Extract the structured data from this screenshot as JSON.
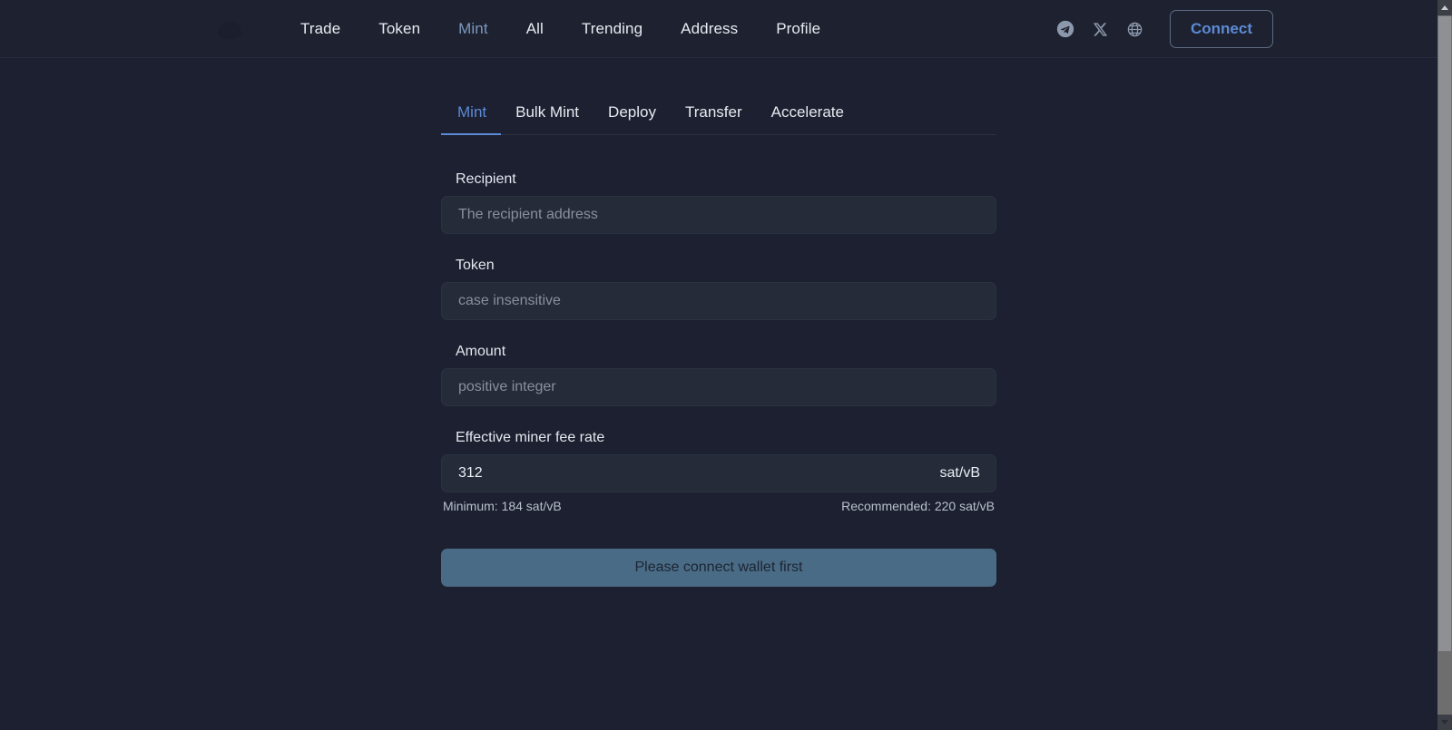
{
  "header": {
    "logo_alt": "site-logo",
    "nav": [
      {
        "label": "Trade",
        "active": false
      },
      {
        "label": "Token",
        "active": false
      },
      {
        "label": "Mint",
        "active": true
      },
      {
        "label": "All",
        "active": false
      },
      {
        "label": "Trending",
        "active": false
      },
      {
        "label": "Address",
        "active": false
      },
      {
        "label": "Profile",
        "active": false
      }
    ],
    "social": [
      {
        "name": "telegram-icon"
      },
      {
        "name": "x-twitter-icon"
      },
      {
        "name": "globe-icon"
      }
    ],
    "connect_label": "Connect"
  },
  "tabs": [
    {
      "label": "Mint",
      "active": true
    },
    {
      "label": "Bulk Mint",
      "active": false
    },
    {
      "label": "Deploy",
      "active": false
    },
    {
      "label": "Transfer",
      "active": false
    },
    {
      "label": "Accelerate",
      "active": false
    }
  ],
  "form": {
    "recipient": {
      "label": "Recipient",
      "placeholder": "The recipient address",
      "value": ""
    },
    "token": {
      "label": "Token",
      "placeholder": "case insensitive",
      "value": ""
    },
    "amount": {
      "label": "Amount",
      "placeholder": "positive integer",
      "value": ""
    },
    "fee_rate": {
      "label": "Effective miner fee rate",
      "value": "312",
      "unit": "sat/vB",
      "minimum_hint": "Minimum: 184 sat/vB",
      "recommended_hint": "Recommended: 220 sat/vB"
    },
    "submit_label": "Please connect wallet first"
  },
  "colors": {
    "page_bg": "#1c2030",
    "header_bg": "#1e2230",
    "input_bg": "#252b38",
    "accent": "#5b8ad6",
    "submit_bg": "#4a6b85",
    "nav_active": "#7d98be"
  }
}
